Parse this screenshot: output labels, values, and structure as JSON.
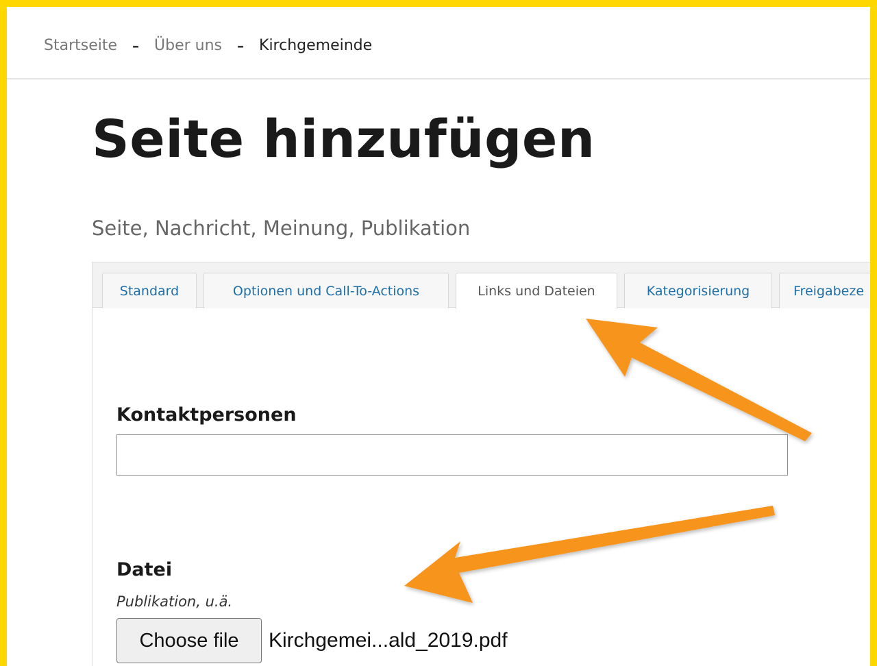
{
  "breadcrumb": {
    "items": [
      "Startseite",
      "Über uns",
      "Kirchgemeinde"
    ],
    "separator": "–"
  },
  "page": {
    "title": "Seite hinzufügen",
    "subtitle": "Seite, Nachricht, Meinung, Publikation"
  },
  "tabs": [
    {
      "label": "Standard",
      "active": false
    },
    {
      "label": "Optionen und Call-To-Actions",
      "active": false
    },
    {
      "label": "Links und Dateien",
      "active": true
    },
    {
      "label": "Kategorisierung",
      "active": false
    },
    {
      "label": "Freigabeze",
      "active": false
    }
  ],
  "form": {
    "contacts": {
      "label": "Kontaktpersonen",
      "value": ""
    },
    "file": {
      "label": "Datei",
      "hint": "Publikation, u.ä.",
      "button_label": "Choose file",
      "selected_file": "Kirchgemei...ald_2019.pdf"
    }
  },
  "colors": {
    "frame": "#FFD700",
    "arrow": "#F7941D",
    "tab_link": "#1F6FA8"
  },
  "annotations": {
    "arrows": [
      "arrow-icon",
      "arrow-icon"
    ]
  }
}
